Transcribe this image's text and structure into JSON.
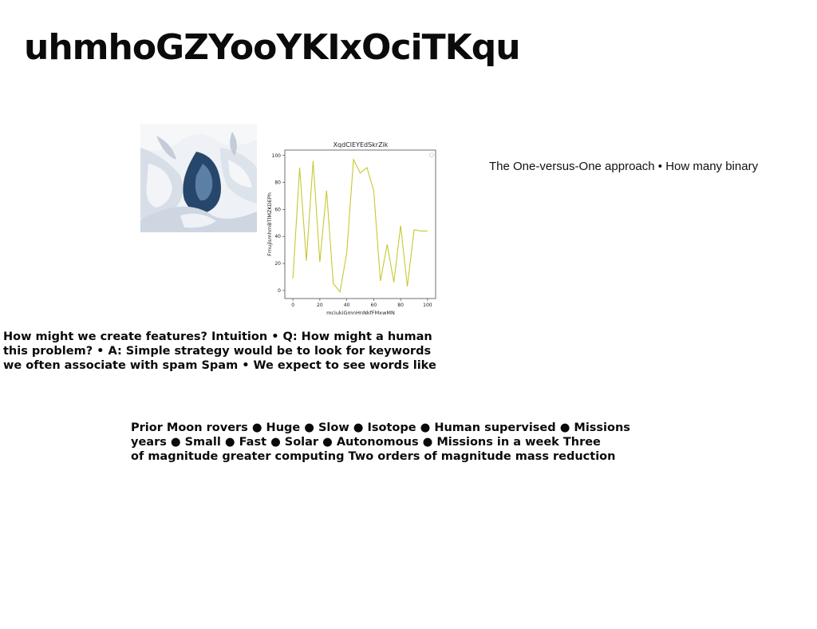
{
  "slide": {
    "title": "uhmhoGZYooYKIxOciTKqu",
    "side_text": "The One-versus-One approach • How many binary",
    "paragraph1": [
      "How might we create features? Intuition • Q: How might a human",
      "this problem? • A: Simple strategy would be to look for keywords",
      "we often associate with spam Spam • We expect to see words like"
    ],
    "paragraph2": [
      "Prior Moon rovers ● Huge ● Slow ● Isotope ● Human supervised ● Missions",
      "years ● Small ● Fast ● Solar ● Autonomous ● Missions in a week Three",
      "of magnitude greater computing Two orders of magnitude mass reduction"
    ]
  },
  "colors": {
    "line": "#c8c832",
    "axis": "#333333"
  },
  "chart_data": {
    "type": "line",
    "title": "XqdClEYEdSkrZik",
    "xlabel": "mciukiGmnHnNkfFMxwMN",
    "ylabel": "FmujlsmhmBTlMZKDEPh",
    "xlim": [
      -6,
      106
    ],
    "ylim": [
      -6,
      104
    ],
    "xticks": [
      0,
      20,
      40,
      60,
      80,
      100
    ],
    "yticks": [
      0,
      20,
      40,
      60,
      80,
      100
    ],
    "x": [
      0,
      5,
      10,
      15,
      20,
      25,
      30,
      35,
      40,
      45,
      50,
      55,
      60,
      65,
      70,
      75,
      80,
      85,
      90,
      95,
      100
    ],
    "values": [
      9,
      91,
      22,
      96,
      21,
      74,
      5,
      -1,
      28,
      97,
      87,
      91,
      74,
      7,
      34,
      6,
      48,
      3,
      45,
      44,
      44
    ]
  }
}
